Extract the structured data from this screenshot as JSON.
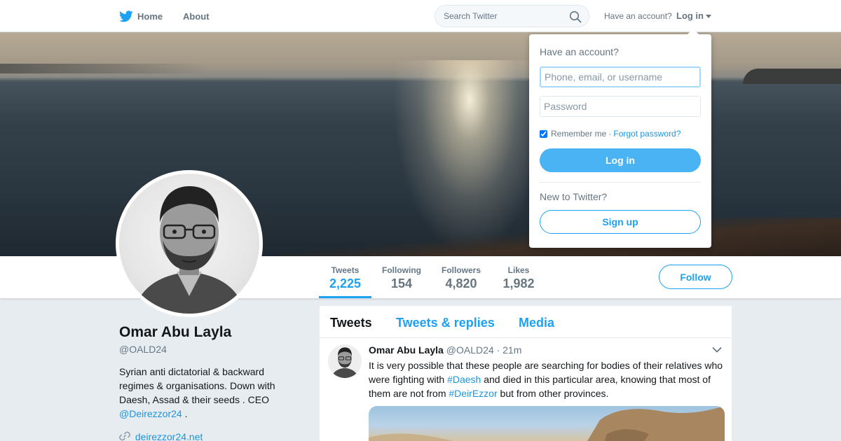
{
  "nav": {
    "home_label": "Home",
    "about_label": "About",
    "search_placeholder": "Search Twitter",
    "have_account_label": "Have an account?",
    "login_label": "Log in"
  },
  "profile": {
    "name": "Omar Abu Layla",
    "handle": "@OALD24",
    "bio_text": "Syrian anti dictatorial & backward regimes & organisations. Down with Daesh, Assad & their seeds . CEO",
    "bio_mention": "@Deirezzor24",
    "bio_end": " .",
    "url": "deirezzor24.net"
  },
  "stats": [
    {
      "label": "Tweets",
      "value": "2,225"
    },
    {
      "label": "Following",
      "value": "154"
    },
    {
      "label": "Followers",
      "value": "4,820"
    },
    {
      "label": "Likes",
      "value": "1,982"
    }
  ],
  "follow_label": "Follow",
  "timeline": {
    "tabs": [
      "Tweets",
      "Tweets & replies",
      "Media"
    ],
    "tweet": {
      "name": "Omar Abu Layla",
      "handle": "@OALD24",
      "separator": "·",
      "time": "21m",
      "text_1": "It is very possible that these people are searching for bodies of their relatives who were fighting with ",
      "hashtag_1": "#Daesh",
      "text_2": " and died in this particular area, knowing that most of them are not from ",
      "hashtag_2": "#DeirEzzor",
      "text_3": " but from other provinces."
    }
  },
  "login_dropdown": {
    "title": "Have an account?",
    "username_placeholder": "Phone, email, or username",
    "password_placeholder": "Password",
    "remember_label": "Remember me",
    "separator": "·",
    "forgot_label": "Forgot password?",
    "login_button": "Log in",
    "new_label": "New to Twitter?",
    "signup_button": "Sign up"
  },
  "colors": {
    "accent": "#1da1f2",
    "link": "#1b95e0"
  },
  "icons": [
    "twitter-bird-icon",
    "search-icon",
    "chevron-down-icon",
    "link-icon"
  ]
}
